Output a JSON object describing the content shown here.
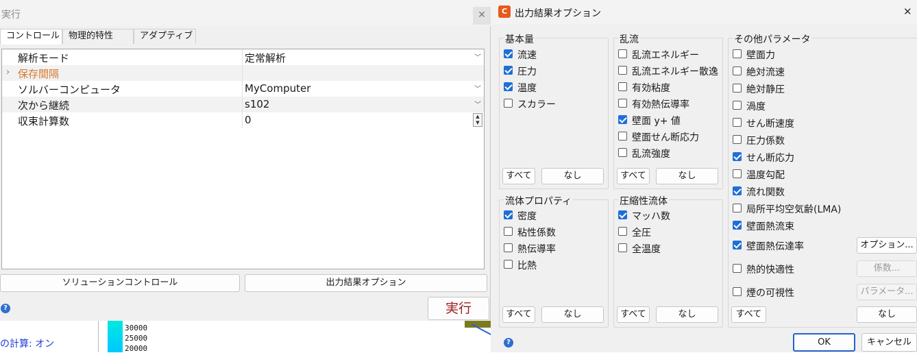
{
  "background": {
    "link_text": "の計算: オン",
    "legend_ticks": [
      "30000",
      "25000",
      "20000"
    ]
  },
  "run_dialog": {
    "title": "実行",
    "close_icon": "✕",
    "tabs": [
      "コントロール",
      "物理的特性",
      "アダプティブ"
    ],
    "rows": [
      {
        "key": "解析モード",
        "value": "定常解析"
      },
      {
        "key": "保存間隔",
        "value": ""
      },
      {
        "key": "ソルバーコンピュータ",
        "value": "MyComputer"
      },
      {
        "key": "次から継続",
        "value": "s102"
      },
      {
        "key": "収束計算数",
        "value": "0"
      }
    ],
    "solution_control_label": "ソリューションコントロール",
    "output_options_label": "出力結果オプション",
    "run_label": "実行",
    "help_icon": "?"
  },
  "options_dialog": {
    "title": "出力結果オプション",
    "app_icon": "C",
    "close_icon": "✕",
    "groups": {
      "basic": {
        "label": "基本量",
        "items": [
          {
            "label": "流速",
            "checked": true
          },
          {
            "label": "圧力",
            "checked": true
          },
          {
            "label": "温度",
            "checked": true
          },
          {
            "label": "スカラー",
            "checked": false
          }
        ],
        "all_label": "すべて",
        "none_label": "なし"
      },
      "turbulence": {
        "label": "乱流",
        "items": [
          {
            "label": "乱流エネルギー",
            "checked": false
          },
          {
            "label": "乱流エネルギー散逸",
            "checked": false
          },
          {
            "label": "有効粘度",
            "checked": false
          },
          {
            "label": "有効熱伝導率",
            "checked": false
          },
          {
            "label": "壁面 y+ 値",
            "checked": true
          },
          {
            "label": "壁面せん断応力",
            "checked": false
          },
          {
            "label": "乱流強度",
            "checked": false
          }
        ],
        "all_label": "すべて",
        "none_label": "なし"
      },
      "fluid": {
        "label": "流体プロパティ",
        "items": [
          {
            "label": "密度",
            "checked": true
          },
          {
            "label": "粘性係数",
            "checked": false
          },
          {
            "label": "熱伝導率",
            "checked": false
          },
          {
            "label": "比熱",
            "checked": false
          }
        ],
        "all_label": "すべて",
        "none_label": "なし"
      },
      "compressible": {
        "label": "圧縮性流体",
        "items": [
          {
            "label": "マッハ数",
            "checked": true
          },
          {
            "label": "全圧",
            "checked": false
          },
          {
            "label": "全温度",
            "checked": false
          }
        ],
        "all_label": "すべて",
        "none_label": "なし"
      },
      "other": {
        "label": "その他パラメータ",
        "items": [
          {
            "label": "壁面力",
            "checked": false
          },
          {
            "label": "絶対流速",
            "checked": false
          },
          {
            "label": "絶対静圧",
            "checked": false
          },
          {
            "label": "渦度",
            "checked": false
          },
          {
            "label": "せん断速度",
            "checked": false
          },
          {
            "label": "圧力係数",
            "checked": false
          },
          {
            "label": "せん断応力",
            "checked": true
          },
          {
            "label": "温度勾配",
            "checked": false
          },
          {
            "label": "流れ関数",
            "checked": true
          },
          {
            "label": "局所平均空気齢(LMA)",
            "checked": false
          },
          {
            "label": "壁面熱流束",
            "checked": true
          },
          {
            "label": "壁面熱伝達率",
            "checked": true
          },
          {
            "label": "熱的快適性",
            "checked": false
          },
          {
            "label": "煙の可視性",
            "checked": false
          }
        ],
        "options_label": "オプション...",
        "coefficients_label": "係数...",
        "parameters_label": "パラメータ...",
        "all_label": "すべて",
        "none_label": "なし"
      }
    },
    "ok_label": "OK",
    "cancel_label": "キャンセル",
    "help_icon": "?"
  }
}
